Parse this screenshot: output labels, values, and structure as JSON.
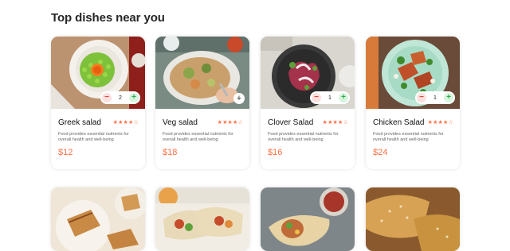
{
  "section": {
    "title": "Top dishes near you"
  },
  "dishes": [
    {
      "name": "Greek salad",
      "rating": "★★★★☆",
      "description": "Food provides essential nutrients for overall health and well-being",
      "price": "$12",
      "count": "2",
      "minus": "−",
      "plus": "+"
    },
    {
      "name": "Veg salad",
      "rating": "★★★★☆",
      "description": "Food provides essential nutrients for overall health and well-being",
      "price": "$18",
      "add": "+"
    },
    {
      "name": "Clover Salad",
      "rating": "★★★★☆",
      "description": "Food provides essential nutrients for overall health and well-being",
      "price": "$16",
      "count": "1",
      "minus": "−",
      "plus": "+"
    },
    {
      "name": "Chicken Salad",
      "rating": "★★★★☆",
      "description": "Food provides essential nutrients for overall health and well-being",
      "price": "$24",
      "count": "1",
      "minus": "−",
      "plus": "+"
    }
  ],
  "colors": {
    "accent": "#ff6e43",
    "minus": "#e3443a",
    "plus": "#2ea84b"
  }
}
